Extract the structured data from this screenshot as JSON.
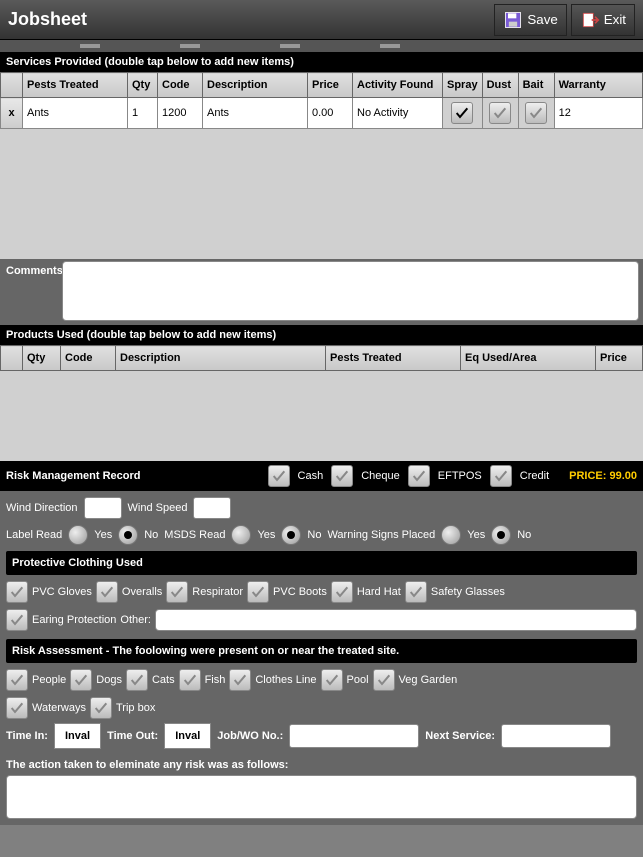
{
  "header": {
    "title": "Jobsheet",
    "save": "Save",
    "exit": "Exit"
  },
  "services": {
    "heading": "Services Provided (double tap below to add new items)",
    "cols": {
      "pests": "Pests Treated",
      "qty": "Qty",
      "code": "Code",
      "desc": "Description",
      "price": "Price",
      "activity": "Activity Found",
      "spray": "Spray",
      "dust": "Dust",
      "bait": "Bait",
      "warranty": "Warranty"
    },
    "row": {
      "del": "x",
      "pests": "Ants",
      "qty": "1",
      "code": "1200",
      "desc": "Ants",
      "price": "0.00",
      "activity": "No Activity",
      "spray": true,
      "dust": false,
      "bait": false,
      "warranty": "12"
    }
  },
  "comments": {
    "label": "Comments",
    "value": ""
  },
  "products": {
    "heading": "Products Used (double tap below to add new items)",
    "cols": {
      "qty": "Qty",
      "code": "Code",
      "desc": "Description",
      "pests": "Pests Treated",
      "eq": "Eq Used/Area",
      "price": "Price"
    }
  },
  "risk": {
    "heading": "Risk Management Record",
    "pay": {
      "cash": "Cash",
      "cheque": "Cheque",
      "eftpos": "EFTPOS",
      "credit": "Credit"
    },
    "price_label": "PRICE:",
    "price_value": "99.00"
  },
  "wind": {
    "dir": "Wind Direction",
    "speed": "Wind Speed"
  },
  "reads": {
    "label_read": "Label Read",
    "msds_read": "MSDS Read",
    "warning": "Warning Signs Placed",
    "yes": "Yes",
    "no": "No"
  },
  "clothing": {
    "heading": "Protective Clothing Used",
    "items": {
      "gloves": "PVC Gloves",
      "overalls": "Overalls",
      "respirator": "Respirator",
      "boots": "PVC Boots",
      "hardhat": "Hard Hat",
      "glasses": "Safety Glasses",
      "earing": "Earing Protection"
    },
    "other": "Other:"
  },
  "assessment": {
    "heading": "Risk Assessment - The foolowing were present on or near the treated site.",
    "items": {
      "people": "People",
      "dogs": "Dogs",
      "cats": "Cats",
      "fish": "Fish",
      "clothes": "Clothes Line",
      "pool": "Pool",
      "veg": "Veg Garden",
      "water": "Waterways",
      "trip": "Trip box"
    }
  },
  "times": {
    "in": "Time In:",
    "out": "Time Out:",
    "inval": "Inval",
    "job": "Job/WO No.:",
    "next": "Next Service:"
  },
  "action": {
    "label": "The action taken to eleminate any risk was as follows:"
  }
}
